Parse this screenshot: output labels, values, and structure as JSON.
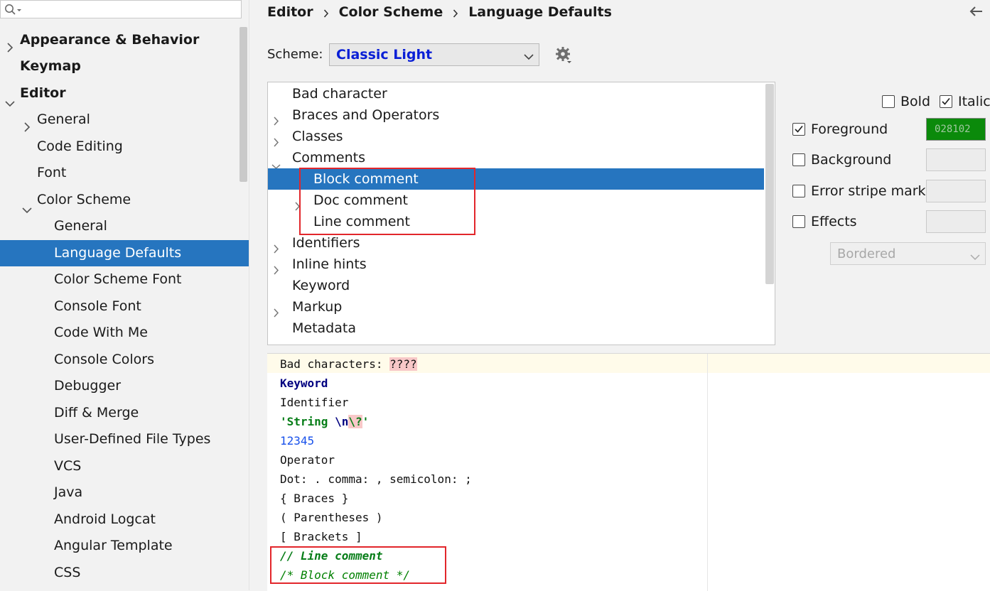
{
  "search": {
    "placeholder": ""
  },
  "sidebar": {
    "items": [
      {
        "label": "Appearance & Behavior",
        "expanded": false
      },
      {
        "label": "Keymap"
      },
      {
        "label": "Editor",
        "expanded": true
      },
      {
        "label": "General",
        "expanded": false
      },
      {
        "label": "Code Editing"
      },
      {
        "label": "Font"
      },
      {
        "label": "Color Scheme",
        "expanded": true
      },
      {
        "label": "General"
      },
      {
        "label": "Language Defaults",
        "selected": true
      },
      {
        "label": "Color Scheme Font"
      },
      {
        "label": "Console Font"
      },
      {
        "label": "Code With Me"
      },
      {
        "label": "Console Colors"
      },
      {
        "label": "Debugger"
      },
      {
        "label": "Diff & Merge"
      },
      {
        "label": "User-Defined File Types"
      },
      {
        "label": "VCS"
      },
      {
        "label": "Java"
      },
      {
        "label": "Android Logcat"
      },
      {
        "label": "Angular Template"
      },
      {
        "label": "CSS"
      }
    ]
  },
  "breadcrumb": [
    "Editor",
    "Color Scheme",
    "Language Defaults"
  ],
  "scheme": {
    "label": "Scheme:",
    "value": "Classic Light"
  },
  "tree": {
    "items": [
      {
        "label": "Bad character"
      },
      {
        "label": "Braces and Operators",
        "expandable": true
      },
      {
        "label": "Classes",
        "expandable": true
      },
      {
        "label": "Comments",
        "expanded": true
      },
      {
        "label": "Block comment",
        "selected": true
      },
      {
        "label": "Doc comment",
        "expandable": true
      },
      {
        "label": "Line comment"
      },
      {
        "label": "Identifiers",
        "expandable": true
      },
      {
        "label": "Inline hints",
        "expandable": true
      },
      {
        "label": "Keyword"
      },
      {
        "label": "Markup",
        "expandable": true
      },
      {
        "label": "Metadata"
      }
    ]
  },
  "attributes": {
    "bold": {
      "label": "Bold",
      "checked": false
    },
    "italic": {
      "label": "Italic",
      "checked": true
    },
    "foreground": {
      "label": "Foreground",
      "checked": true,
      "color": "028102"
    },
    "background": {
      "label": "Background",
      "checked": false
    },
    "error_stripe": {
      "label": "Error stripe mark",
      "checked": false
    },
    "effects": {
      "label": "Effects",
      "checked": false,
      "style": "Bordered"
    }
  },
  "preview": {
    "bad_prefix": "Bad characters: ",
    "bad_value": "????",
    "keyword": "Keyword",
    "identifier": "Identifier",
    "string_start": "'String ",
    "string_escape": "\\n",
    "string_bad_escape": "\\?",
    "string_end": "'",
    "number": "12345",
    "operator": "Operator",
    "punctuation": "Dot: . comma: , semicolon: ;",
    "braces": "{ Braces }",
    "parentheses": "( Parentheses )",
    "brackets": "[ Brackets ]",
    "line_comment": "// Line comment",
    "block_comment": "/* Block comment */"
  },
  "colors": {
    "selection": "#2675bf",
    "foreground_swatch": "#0b8a0b",
    "highlight_border": "#e2262b",
    "scheme_value": "#0a1fd6"
  }
}
